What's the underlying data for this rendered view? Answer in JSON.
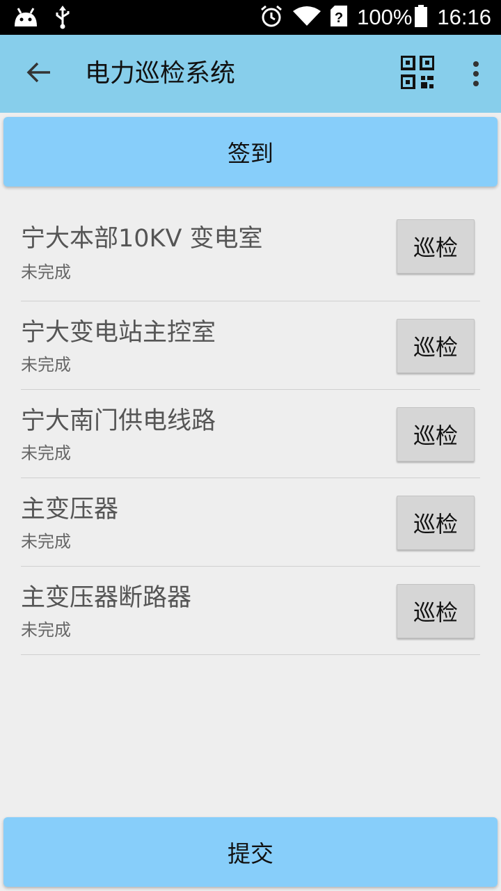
{
  "status_bar": {
    "battery_text": "100%",
    "time": "16:16",
    "icons": [
      "android-icon",
      "usb-icon",
      "alarm-icon",
      "wifi-icon",
      "sim-unknown-icon",
      "battery-icon"
    ]
  },
  "toolbar": {
    "title": "电力巡检系统",
    "icons": [
      "back-arrow-icon",
      "qr-code-icon",
      "more-vert-icon"
    ]
  },
  "signin_label": "签到",
  "submit_label": "提交",
  "items": [
    {
      "name": "宁大本部10KV 变电室",
      "status": "未完成",
      "action": "巡检"
    },
    {
      "name": "宁大变电站主控室",
      "status": "未完成",
      "action": "巡检"
    },
    {
      "name": "宁大南门供电线路",
      "status": "未完成",
      "action": "巡检"
    },
    {
      "name": "主变压器",
      "status": "未完成",
      "action": "巡检"
    },
    {
      "name": "主变压器断路器",
      "status": "未完成",
      "action": "巡检"
    }
  ],
  "colors": {
    "toolbar": "#87ceeb",
    "primary_button": "#87cefa",
    "background": "#eeeeee",
    "row_button": "#d6d6d6"
  }
}
